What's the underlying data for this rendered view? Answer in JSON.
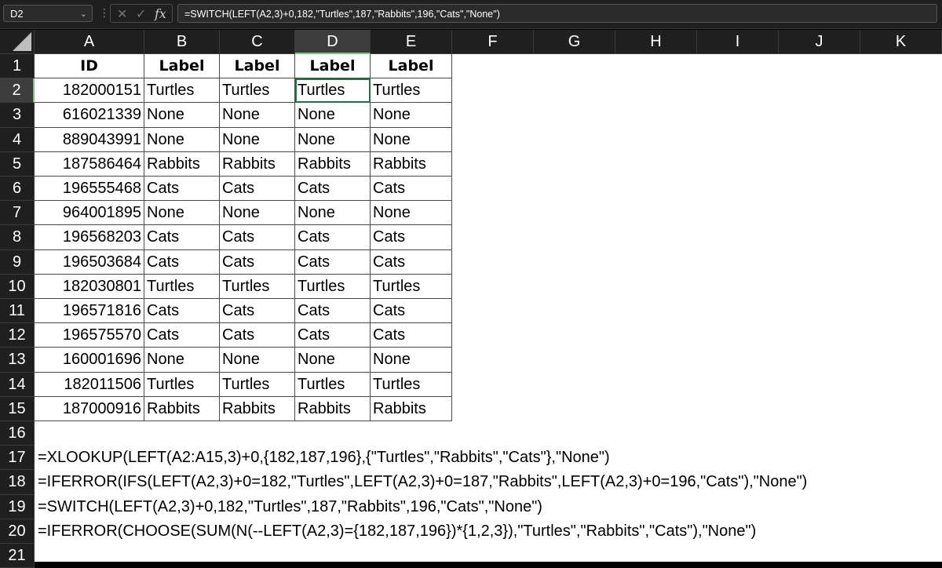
{
  "formula_bar": {
    "name_box": "D2",
    "formula": "=SWITCH(LEFT(A2,3)+0,182,\"Turtles\",187,\"Rabbits\",196,\"Cats\",\"None\")"
  },
  "columns": [
    "A",
    "B",
    "C",
    "D",
    "E",
    "F",
    "G",
    "H",
    "I",
    "J",
    "K"
  ],
  "rows": [
    "1",
    "2",
    "3",
    "4",
    "5",
    "6",
    "7",
    "8",
    "9",
    "10",
    "11",
    "12",
    "13",
    "14",
    "15",
    "16",
    "17",
    "18",
    "19",
    "20",
    "21"
  ],
  "header": [
    "ID",
    "Label",
    "Label",
    "Label",
    "Label"
  ],
  "table": [
    [
      "182000151",
      "Turtles",
      "Turtles",
      "Turtles",
      "Turtles"
    ],
    [
      "616021339",
      "None",
      "None",
      "None",
      "None"
    ],
    [
      "889043991",
      "None",
      "None",
      "None",
      "None"
    ],
    [
      "187586464",
      "Rabbits",
      "Rabbits",
      "Rabbits",
      "Rabbits"
    ],
    [
      "196555468",
      "Cats",
      "Cats",
      "Cats",
      "Cats"
    ],
    [
      "964001895",
      "None",
      "None",
      "None",
      "None"
    ],
    [
      "196568203",
      "Cats",
      "Cats",
      "Cats",
      "Cats"
    ],
    [
      "196503684",
      "Cats",
      "Cats",
      "Cats",
      "Cats"
    ],
    [
      "182030801",
      "Turtles",
      "Turtles",
      "Turtles",
      "Turtles"
    ],
    [
      "196571816",
      "Cats",
      "Cats",
      "Cats",
      "Cats"
    ],
    [
      "196575570",
      "Cats",
      "Cats",
      "Cats",
      "Cats"
    ],
    [
      "160001696",
      "None",
      "None",
      "None",
      "None"
    ],
    [
      "182011506",
      "Turtles",
      "Turtles",
      "Turtles",
      "Turtles"
    ],
    [
      "187000916",
      "Rabbits",
      "Rabbits",
      "Rabbits",
      "Rabbits"
    ]
  ],
  "formulas": [
    "=XLOOKUP(LEFT(A2:A15,3)+0,{182,187,196},{\"Turtles\",\"Rabbits\",\"Cats\"},\"None\")",
    "=IFERROR(IFS(LEFT(A2,3)+0=182,\"Turtles\",LEFT(A2,3)+0=187,\"Rabbits\",LEFT(A2,3)+0=196,\"Cats\"),\"None\")",
    "=SWITCH(LEFT(A2,3)+0,182,\"Turtles\",187,\"Rabbits\",196,\"Cats\",\"None\")",
    "=IFERROR(CHOOSE(SUM(N(--LEFT(A2,3)={182,187,196})*{1,2,3}),\"Turtles\",\"Rabbits\",\"Cats\"),\"None\")"
  ],
  "selection": {
    "active_cell": "D2",
    "active_column": "D",
    "active_row": "2"
  },
  "colors": {
    "background": "#000000",
    "header_bg": "#1f1f1f",
    "cell_bg": "#ffffff",
    "selection": "#217346"
  }
}
